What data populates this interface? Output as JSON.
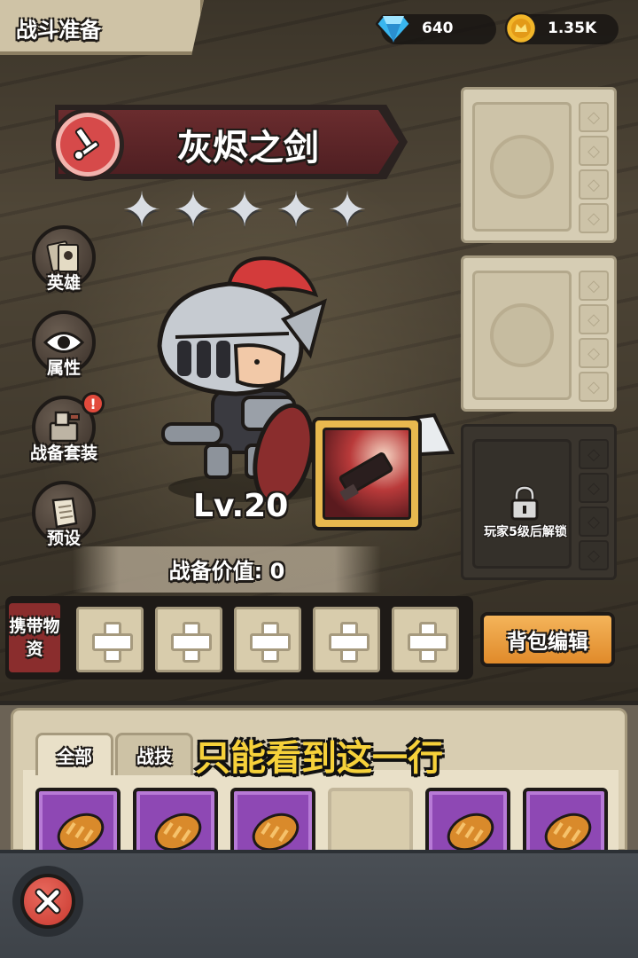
{
  "header": {
    "title": "战斗准备",
    "gems": {
      "icon": "diamond-icon",
      "value": "640"
    },
    "gold": {
      "icon": "gold-coin-icon",
      "value": "1.35K"
    }
  },
  "weapon": {
    "name": "灰烬之剑",
    "emblem_icon": "sword-emblem-icon",
    "stars": 5,
    "level": "Lv.20"
  },
  "side_menu": [
    {
      "id": "hero",
      "label": "英雄",
      "icon": "hero-cards-icon",
      "badge": false
    },
    {
      "id": "attributes",
      "label": "属性",
      "icon": "eye-icon",
      "badge": false
    },
    {
      "id": "gear-set",
      "label": "战备套装",
      "icon": "gear-set-icon",
      "badge": true,
      "badge_text": "!"
    },
    {
      "id": "preset",
      "label": "预设",
      "icon": "scroll-icon",
      "badge": false
    }
  ],
  "gear_value": "战备价值: 0",
  "equipment_slots": {
    "locked_text": "玩家5级后解锁"
  },
  "carry": {
    "label": "携带物资",
    "slot_count": 5,
    "bag_button": "背包编辑"
  },
  "inventory": {
    "tabs": [
      "全部",
      "战技"
    ],
    "active_tab": "全部",
    "items": [
      "bread",
      "bread",
      "bread",
      "empty",
      "bread",
      "bread"
    ]
  },
  "overlay_caption": "只能看到这一行",
  "colors": {
    "banner": "#5a2326",
    "emblem": "#d64a4a",
    "bag_button": "#e99a38",
    "item_rarity_purple": "#8e48b4",
    "caption": "#f6d13a",
    "close_button": "#d54a3e"
  }
}
